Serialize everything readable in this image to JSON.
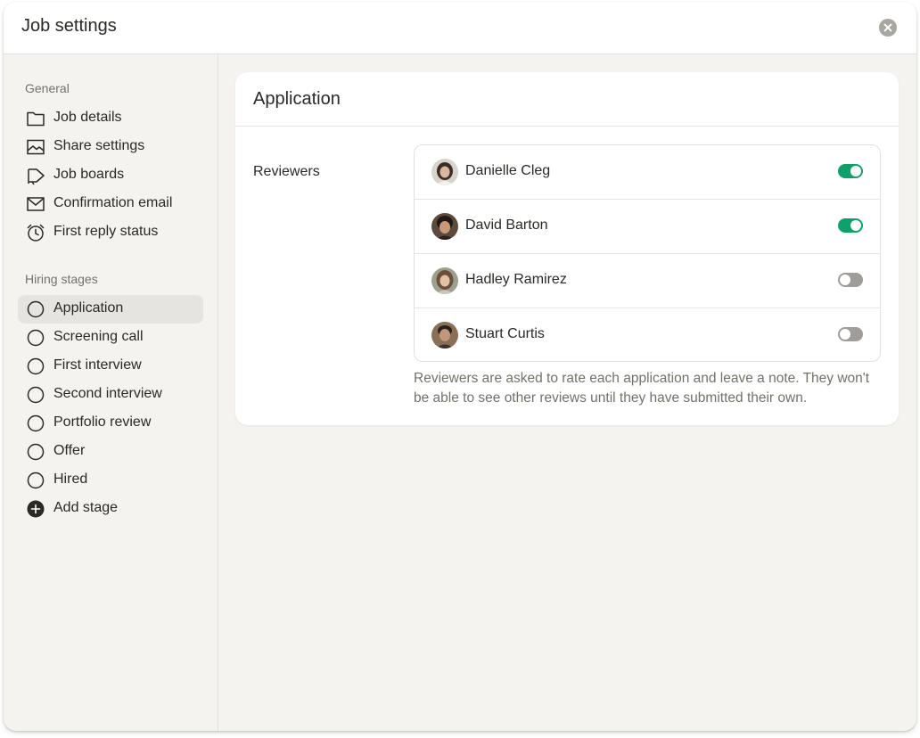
{
  "window": {
    "title": "Job settings",
    "close_icon": "close-circle-icon"
  },
  "sidebar": {
    "general": {
      "label": "General",
      "items": [
        {
          "label": "Job details",
          "icon": "folder-icon"
        },
        {
          "label": "Share settings",
          "icon": "image-icon"
        },
        {
          "label": "Job boards",
          "icon": "megaphone-icon"
        },
        {
          "label": "Confirmation email",
          "icon": "mail-icon"
        },
        {
          "label": "First reply status",
          "icon": "alarm-clock-icon"
        }
      ]
    },
    "hiring_stages": {
      "label": "Hiring stages",
      "items": [
        {
          "label": "Application",
          "icon": "circle-icon",
          "active": true
        },
        {
          "label": "Screening call",
          "icon": "circle-icon"
        },
        {
          "label": "First interview",
          "icon": "circle-icon"
        },
        {
          "label": "Second interview",
          "icon": "circle-icon"
        },
        {
          "label": "Portfolio review",
          "icon": "circle-icon"
        },
        {
          "label": "Offer",
          "icon": "circle-icon"
        },
        {
          "label": "Hired",
          "icon": "circle-icon"
        },
        {
          "label": "Add stage",
          "icon": "plus-circle-icon"
        }
      ]
    }
  },
  "main": {
    "card_title": "Application",
    "reviewers_label": "Reviewers",
    "reviewers": [
      {
        "name": "Danielle Cleg",
        "enabled": true
      },
      {
        "name": "David Barton",
        "enabled": true
      },
      {
        "name": "Hadley Ramirez",
        "enabled": false
      },
      {
        "name": "Stuart Curtis",
        "enabled": false
      }
    ],
    "help_text": "Reviewers are asked to rate each application and leave a note. They won't be able to see other reviews until they have submitted their own."
  },
  "colors": {
    "toggle_on": "#12a06a",
    "toggle_off": "#9f9d99",
    "active_nav_bg": "#e6e4e0",
    "app_background": "#f4f3f0"
  }
}
